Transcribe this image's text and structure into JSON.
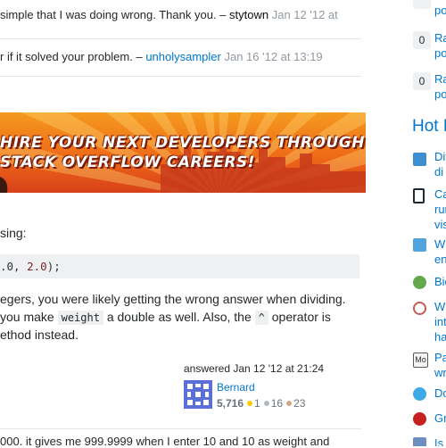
{
  "comments": [
    {
      "text": "simple that I was doing wrong. Thank you. –",
      "user": "stytown",
      "date": "Jan 12 '12 at"
    },
    {
      "text": "r if it solved your problem. –",
      "user": "unholysampler",
      "date": "Jan 16 '12 at 13:19"
    }
  ],
  "banner": {
    "line1": "HIRE YOUR NEXT DEVELOPERS THROUGH",
    "line2": "STACK OVERFLOW CAREERS!"
  },
  "answer": {
    "intro": "sing:",
    "code_prefix": ".0, ",
    "code_num": "2.0",
    "code_suffix": ");",
    "para1": "egers, you were likely getting the wrong answer when dividing.",
    "para2_a": "you make",
    "para2_code1": "weight",
    "para2_b": "a double as well. Also, the",
    "para2_code2": "^",
    "para2_c": "operator is",
    "para3": "ethod instead.",
    "bottom_comment": "000. it gives me 999.9999 when I enter 10 and 10 as weight and"
  },
  "signature": {
    "action": "answered Jan 12 '12 at 21:24",
    "user": "Bernard",
    "reputation": "5,716",
    "gold": "1",
    "silver": "16",
    "bronze": "23"
  },
  "sidebar": {
    "linked": [
      {
        "votes": "0",
        "line1": "Ra",
        "line2": "po"
      },
      {
        "votes": "0",
        "line1": "Ra",
        "line2": "po"
      }
    ],
    "linked_top_partial": "po",
    "hot_title": "Hot N",
    "hot": [
      {
        "icon": "arqade-icon",
        "color": "#3d8fd1",
        "line1": "Dif",
        "line2": "di '"
      },
      {
        "icon": "code-review-icon",
        "color": "#1b2a34",
        "line1": "Ca",
        "line2": "run"
      },
      {
        "icon": "chemistry-icon",
        "color": "#52a4dc",
        "line1": "Wh",
        "line2": "ent"
      },
      {
        "icon": "bio-icon",
        "color": "#64a84c",
        "line1": "Bio",
        "line2": ""
      },
      {
        "icon": "board-game-icon",
        "color": "#c65b53",
        "line1": "Wh",
        "line2": "intr"
      },
      {
        "icon": "mo-icon",
        "color": "#5a5a5a",
        "line1": "Pa",
        "line2": "wri"
      },
      {
        "icon": "dos-icon",
        "color": "#3da9e6",
        "line1": "Do",
        "line2": ""
      },
      {
        "icon": "gro-icon",
        "color": "#c5221f",
        "line1": "Gro",
        "line2": ""
      },
      {
        "icon": "last-icon",
        "color": "#6c8fbf",
        "line1": "Is i",
        "line2": ""
      }
    ],
    "extra_line": "visi",
    "extra_line2": "har"
  }
}
